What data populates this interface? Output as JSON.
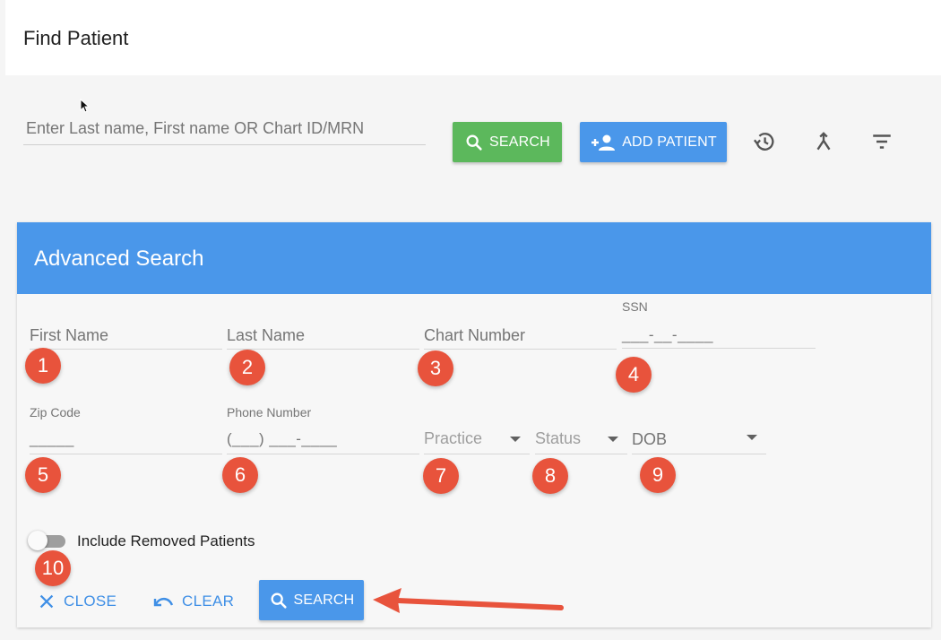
{
  "header": {
    "title": "Find Patient"
  },
  "top_search": {
    "placeholder": "Enter Last name, First name OR Chart ID/MRN",
    "search_label": "SEARCH",
    "add_patient_label": "ADD PATIENT"
  },
  "colors": {
    "green": "#5cb85c",
    "blue": "#4a97ea",
    "badge_red": "#e8533c",
    "link_blue": "#3f8fe6"
  },
  "icons": [
    "search-icon",
    "add-person-icon",
    "history-icon",
    "merge-icon",
    "filter-icon",
    "close-icon",
    "undo-icon"
  ],
  "advanced": {
    "title": "Advanced Search",
    "fields": {
      "first_name": "First Name",
      "last_name": "Last Name",
      "chart_number": "Chart Number",
      "ssn_label": "SSN",
      "ssn_mask": "___-__-____",
      "zip_label": "Zip Code",
      "zip_mask": "_____",
      "phone_label": "Phone Number",
      "phone_mask": "(___) ___-____",
      "practice": "Practice",
      "status": "Status",
      "dob": "DOB"
    },
    "badges": [
      "1",
      "2",
      "3",
      "4",
      "5",
      "6",
      "7",
      "8",
      "9",
      "10"
    ],
    "include_removed_label": "Include Removed Patients",
    "include_removed_on": false,
    "close_label": "CLOSE",
    "clear_label": "CLEAR",
    "search_label": "SEARCH"
  }
}
